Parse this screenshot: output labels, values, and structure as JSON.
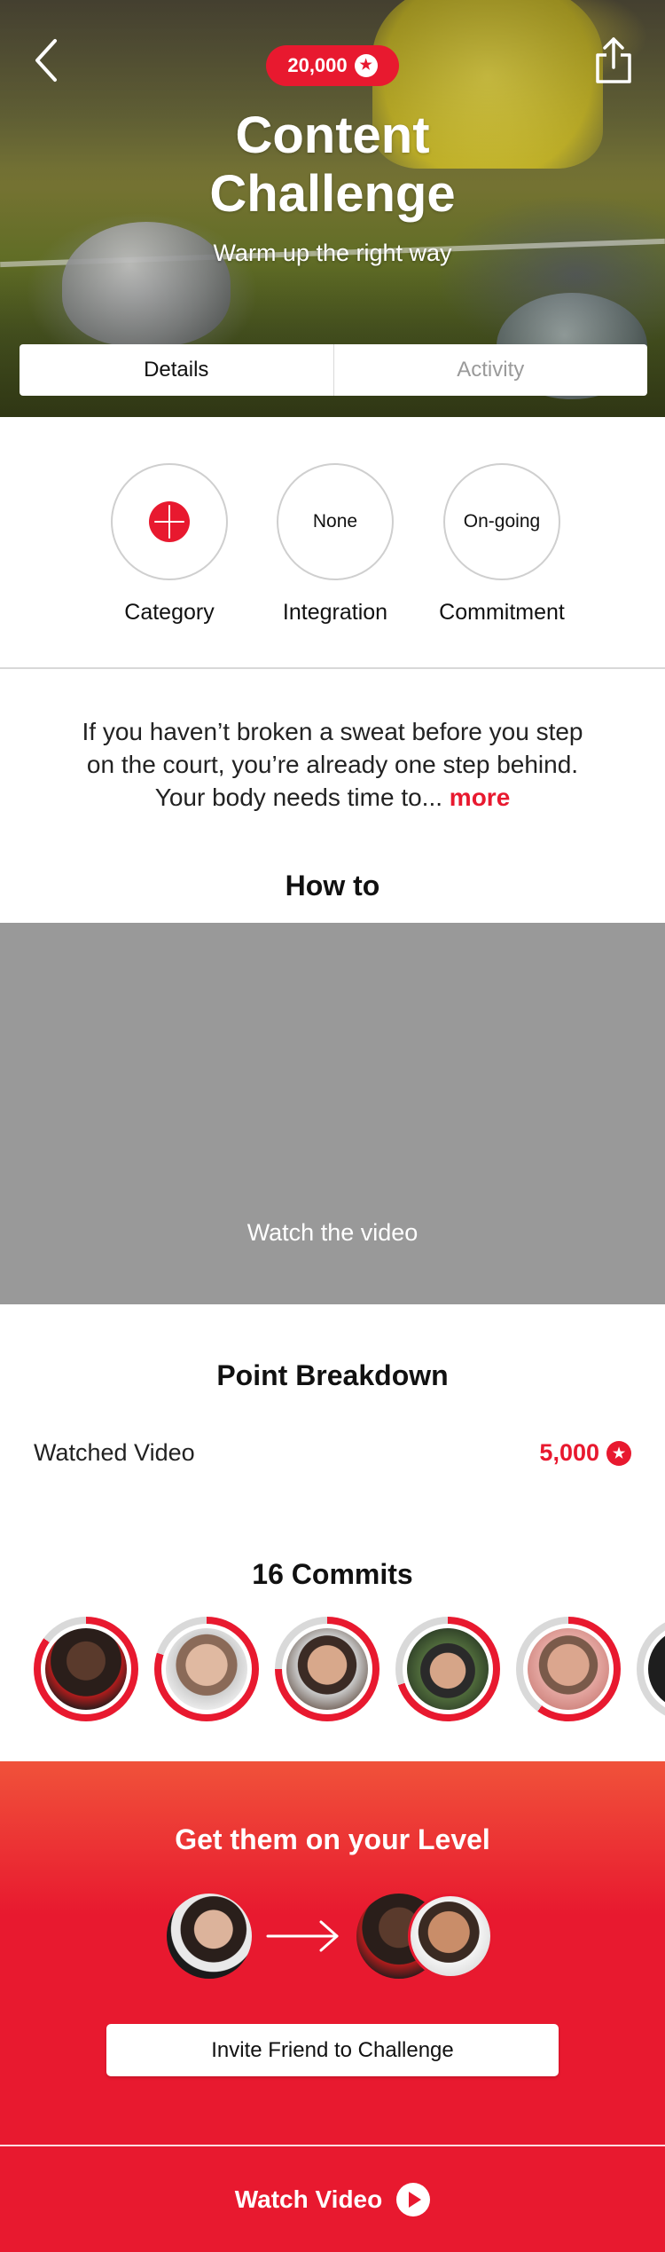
{
  "header": {
    "points": "20,000",
    "title_line1": "Content",
    "title_line2": "Challenge",
    "subtitle": "Warm up the right way"
  },
  "tabs": [
    {
      "label": "Details",
      "active": true
    },
    {
      "label": "Activity",
      "active": false
    }
  ],
  "attributes": [
    {
      "label": "Category",
      "value": "",
      "icon": "brain-icon"
    },
    {
      "label": "Integration",
      "value": "None"
    },
    {
      "label": "Commitment",
      "value": "On-going"
    }
  ],
  "description": {
    "text": "If you haven’t broken a sweat before you step on the court, you’re already one step behind. Your body needs time to...",
    "more": "more"
  },
  "how_to": {
    "title": "How to",
    "video_label": "Watch the video"
  },
  "point_breakdown": {
    "title": "Point Breakdown",
    "items": [
      {
        "label": "Watched Video",
        "value": "5,000"
      }
    ]
  },
  "commits": {
    "title": "16 Commits",
    "progress": [
      0.85,
      0.8,
      0.75,
      0.7,
      0.6,
      0.5
    ]
  },
  "invite": {
    "title": "Get them on your Level",
    "button_label": "Invite Friend to Challenge"
  },
  "footer": {
    "watch_label": "Watch Video"
  },
  "colors": {
    "accent": "#e8192f",
    "video_placeholder": "#999999",
    "ring_track": "#d9d9d9"
  }
}
